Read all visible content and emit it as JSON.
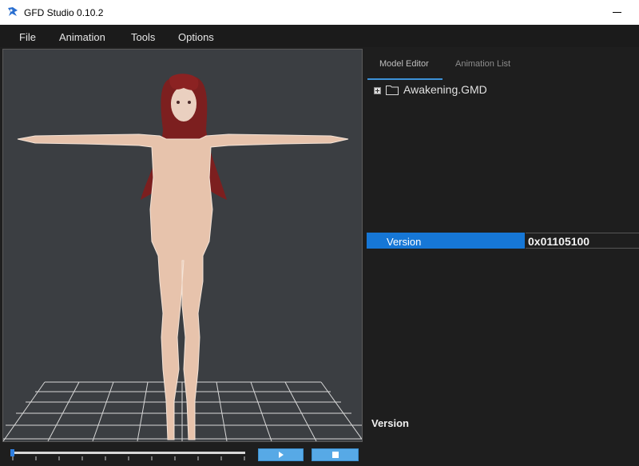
{
  "window": {
    "title": "GFD Studio 0.10.2",
    "app_icon": "gfd-app-icon"
  },
  "menu": {
    "items": [
      {
        "label": "File"
      },
      {
        "label": "Animation"
      },
      {
        "label": "Tools"
      },
      {
        "label": "Options"
      }
    ]
  },
  "right_panel": {
    "tabs": [
      {
        "label": "Model Editor",
        "active": true
      },
      {
        "label": "Animation List",
        "active": false
      }
    ],
    "tree": {
      "root": {
        "label": "Awakening.GMD",
        "icon": "folder-icon",
        "expanded": false
      }
    },
    "properties": {
      "selected": {
        "name": "Version",
        "value": "0x01105100"
      }
    },
    "description": {
      "title": "Version"
    }
  },
  "playback": {
    "progress": 0.0,
    "play_icon": "play-icon",
    "stop_icon": "stop-icon"
  },
  "colors": {
    "accent": "#1677d6",
    "button": "#57a9e6",
    "viewport_bg": "#3b3e42",
    "panel_bg": "#1e1e1e"
  }
}
